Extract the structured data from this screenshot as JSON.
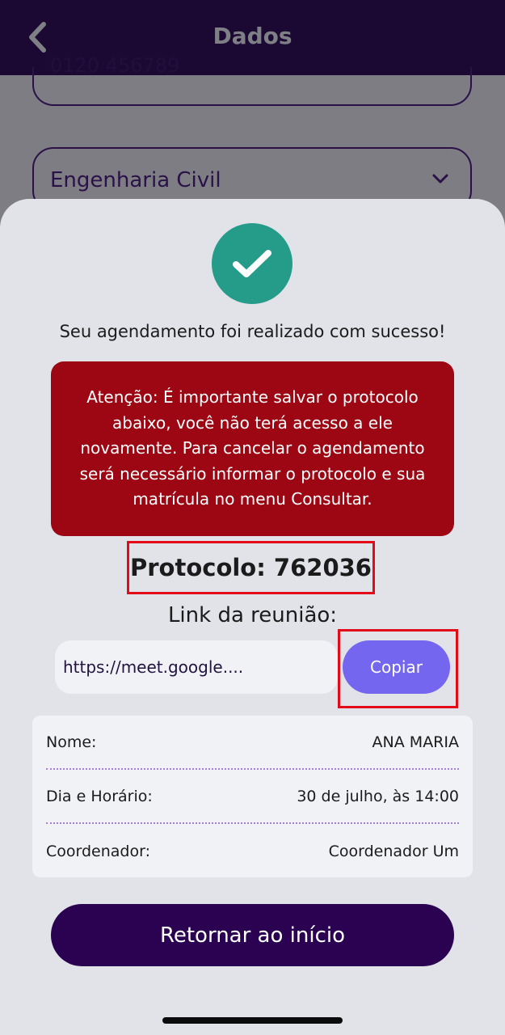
{
  "header": {
    "title": "Dados",
    "back_icon": "chevron-left-icon"
  },
  "background_form": {
    "clipped_field_value": "0120 456789",
    "course_select_value": "Engenharia Civil",
    "course_select_icon": "chevron-down-icon"
  },
  "sheet": {
    "success_icon": "check-circle-icon",
    "success_message": "Seu agendamento foi realizado com sucesso!",
    "alert_message": "Atenção: É importante salvar o protocolo abaixo, você não terá acesso a ele novamente. Para cancelar o agendamento será necessário informar o protocolo e sua matrícula no menu Consultar.",
    "protocol_text": "Protocolo: 762036",
    "link_label": "Link da reunião:",
    "link_value": "https://meet.google....",
    "copy_label": "Copiar",
    "details": [
      {
        "label": "Nome:",
        "value": "ANA MARIA"
      },
      {
        "label": "Dia e Horário:",
        "value": "30 de julho, às 14:00"
      },
      {
        "label": "Coordenador:",
        "value": "Coordenador Um"
      }
    ],
    "return_label": "Retornar ao início"
  },
  "colors": {
    "header_bg": "#1c0933",
    "success_green": "#259b8a",
    "alert_red": "#9c0713",
    "highlight_red": "#e10b1a",
    "copy_button": "#7466ee",
    "primary_button": "#2b0151"
  }
}
